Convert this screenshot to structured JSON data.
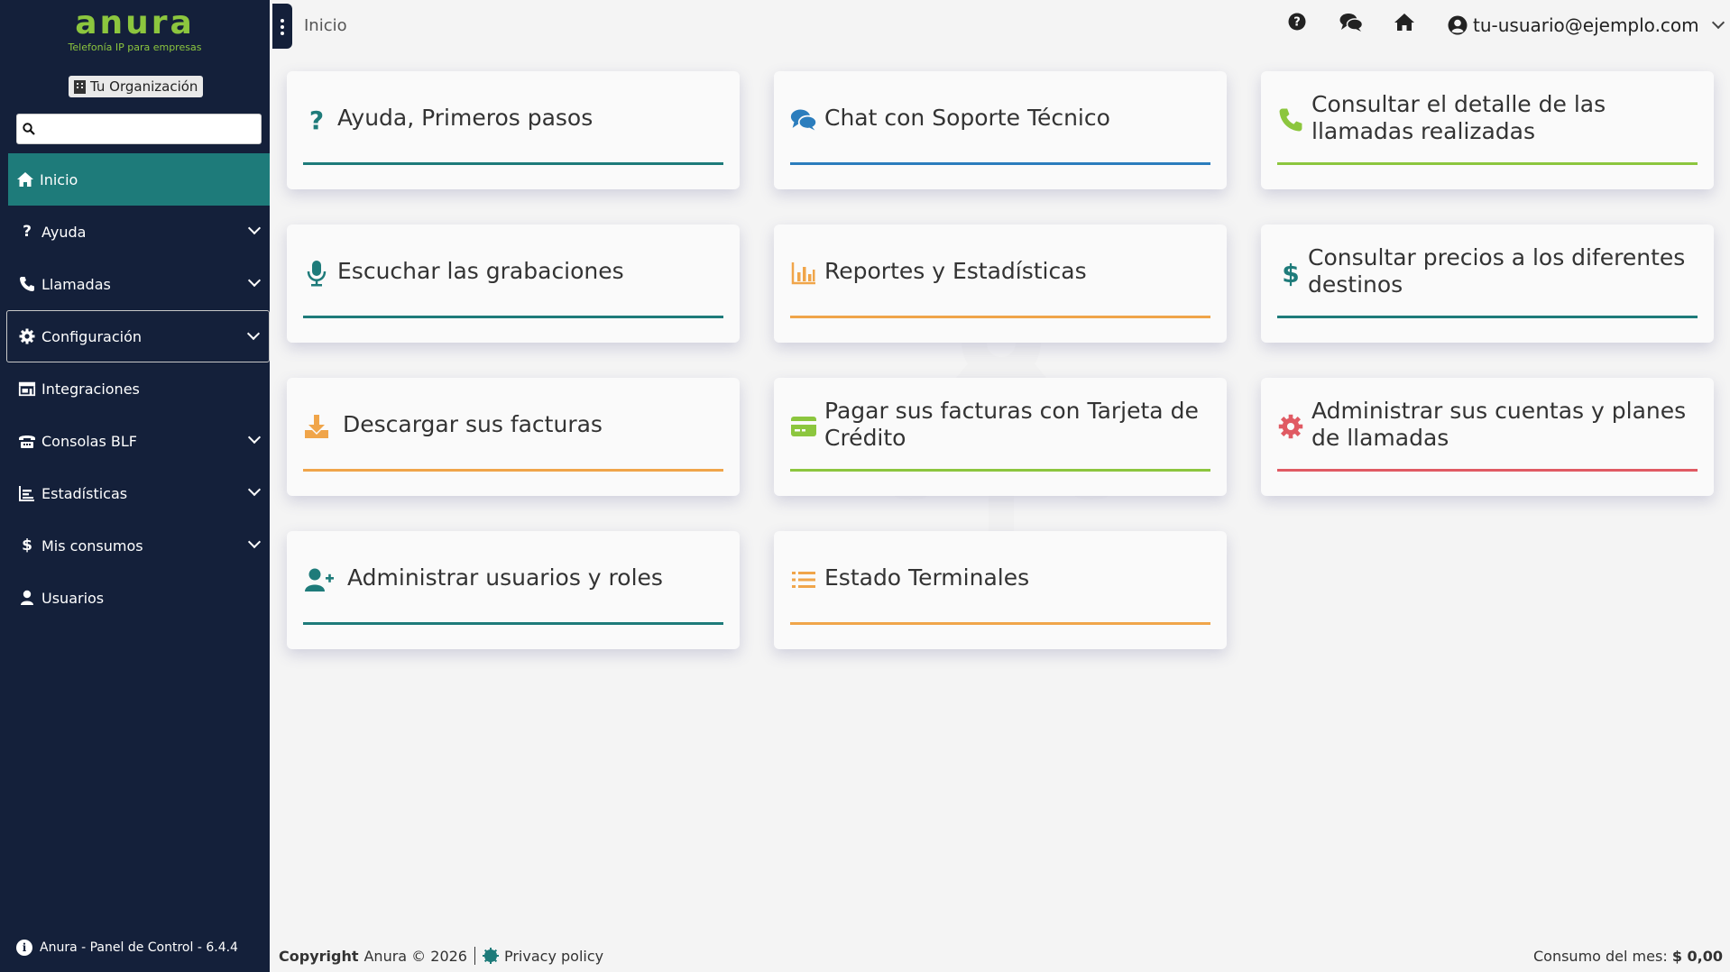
{
  "sidebar": {
    "logo_text": "anura",
    "logo_tagline": "Telefonía IP para empresas",
    "organization": "Tu Organización",
    "search_placeholder": "",
    "items": [
      {
        "label": "Inicio",
        "icon": "home-icon"
      },
      {
        "label": "Ayuda",
        "icon": "question-icon"
      },
      {
        "label": "Llamadas",
        "icon": "phone-icon"
      },
      {
        "label": "Configuración",
        "icon": "gear-icon"
      },
      {
        "label": "Integraciones",
        "icon": "store-icon"
      },
      {
        "label": "Consolas BLF",
        "icon": "console-icon"
      },
      {
        "label": "Estadísticas",
        "icon": "chart-icon"
      },
      {
        "label": "Mis consumos",
        "icon": "dollar-icon"
      },
      {
        "label": "Usuarios",
        "icon": "user-icon"
      }
    ],
    "version": "Anura - Panel de Control - 6.4.4"
  },
  "topbar": {
    "breadcrumb": "Inicio",
    "user_email": "tu-usuario@ejemplo.com"
  },
  "cards": [
    {
      "label": "Ayuda, Primeros pasos",
      "icon": "question-icon",
      "color": "#1e7b7a"
    },
    {
      "label": "Chat con Soporte Técnico",
      "icon": "comments-icon",
      "color": "#2b7dbd"
    },
    {
      "label": "Consultar el detalle de las llamadas realizadas",
      "icon": "phone-icon",
      "color": "#8cc63e"
    },
    {
      "label": "Escuchar las grabaciones",
      "icon": "microphone-icon",
      "color": "#1e7b7a"
    },
    {
      "label": "Reportes y Estadísticas",
      "icon": "bar-chart-icon",
      "color": "#f0a54a"
    },
    {
      "label": "Consultar precios a los diferentes destinos",
      "icon": "dollar-icon",
      "color": "#1e7b7a"
    },
    {
      "label": "Descargar sus facturas",
      "icon": "download-icon",
      "color": "#f0a54a"
    },
    {
      "label": "Pagar sus facturas con Tarjeta de Crédito",
      "icon": "credit-card-icon",
      "color": "#8cc63e"
    },
    {
      "label": "Administrar sus cuentas y planes de llamadas",
      "icon": "gear-icon",
      "color": "#e05a63"
    },
    {
      "label": "Administrar usuarios y roles",
      "icon": "user-plus-icon",
      "color": "#1e7b7a"
    },
    {
      "label": "Estado Terminales",
      "icon": "list-icon",
      "color": "#f0a54a"
    }
  ],
  "footer": {
    "copyright_bold": "Copyright",
    "copyright_rest": "Anura © 2026",
    "privacy": "Privacy policy",
    "consumo_label": "Consumo del mes:",
    "consumo_value": "$ 0,00"
  },
  "colors": {
    "sidebar_bg": "#14203a",
    "active_bg": "#1e7b7a",
    "brand_green": "#8cc63e"
  }
}
